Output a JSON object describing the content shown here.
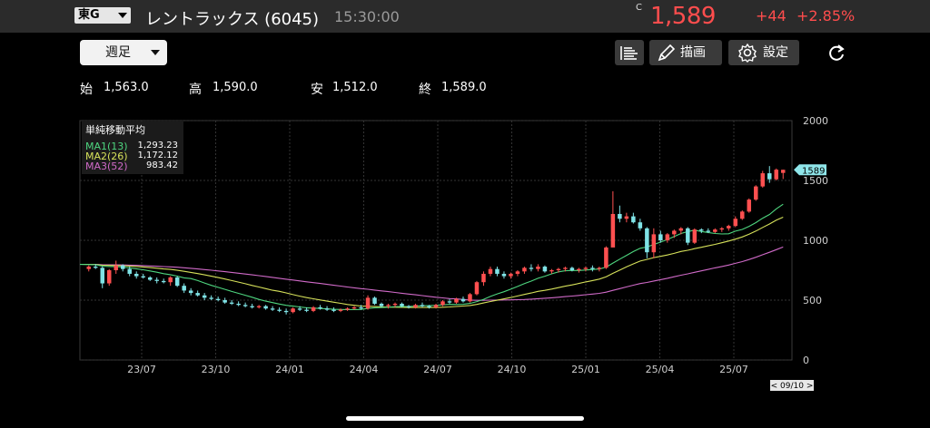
{
  "header": {
    "market": "東G",
    "name": "レントラックス (6045)",
    "time": "15:30:00",
    "close_flag": "C",
    "price": "1,589",
    "change": "+44",
    "change_pct": "+2.85%"
  },
  "toolbar": {
    "period": "週足",
    "draw_label": "描画",
    "settings_label": "設定",
    "list_icon": "list-icon",
    "draw_icon": "pencil-icon",
    "settings_icon": "gear-icon",
    "refresh_icon": "refresh-icon"
  },
  "ohlc": {
    "open_label": "始",
    "open": "1,563.0",
    "high_label": "高",
    "high": "1,590.0",
    "low_label": "安",
    "low": "1,512.0",
    "close_label": "終",
    "close": "1,589.0"
  },
  "colors": {
    "up": "#ff5050",
    "down": "#7fe3e6",
    "ma1": "#4ed67f",
    "ma2": "#d6e15a",
    "ma3": "#d06ac8"
  },
  "chart_data": {
    "type": "candlestick",
    "ma_title": "単純移動平均",
    "ma": [
      {
        "name": "MA1(13)",
        "value": "1,293.23"
      },
      {
        "name": "MA2(26)",
        "value": "1,172.12"
      },
      {
        "name": "MA3(52)",
        "value": "983.42"
      }
    ],
    "y_ticks": [
      "2000",
      "1500",
      "1000",
      "500",
      "0"
    ],
    "y_tick_values": [
      2000,
      1500,
      1000,
      500,
      0
    ],
    "ylim": [
      0,
      2000
    ],
    "x_ticks": [
      "23/07",
      "23/10",
      "24/01",
      "24/04",
      "24/07",
      "24/10",
      "25/01",
      "25/04",
      "25/07"
    ],
    "last_price_label": "1589",
    "last_price": 1589,
    "date_label": "< 09/10 >",
    "candles": [
      [
        760,
        790,
        740,
        780
      ],
      [
        780,
        800,
        760,
        770
      ],
      [
        770,
        780,
        600,
        640
      ],
      [
        640,
        760,
        620,
        750
      ],
      [
        750,
        830,
        720,
        790
      ],
      [
        790,
        800,
        740,
        760
      ],
      [
        760,
        780,
        700,
        720
      ],
      [
        720,
        740,
        680,
        700
      ],
      [
        700,
        720,
        680,
        690
      ],
      [
        690,
        700,
        660,
        670
      ],
      [
        670,
        690,
        640,
        660
      ],
      [
        660,
        680,
        640,
        650
      ],
      [
        650,
        700,
        620,
        690
      ],
      [
        690,
        700,
        610,
        620
      ],
      [
        620,
        640,
        560,
        580
      ],
      [
        580,
        600,
        540,
        560
      ],
      [
        560,
        580,
        530,
        540
      ],
      [
        540,
        560,
        500,
        520
      ],
      [
        520,
        540,
        500,
        510
      ],
      [
        510,
        530,
        490,
        500
      ],
      [
        500,
        520,
        470,
        480
      ],
      [
        480,
        500,
        460,
        470
      ],
      [
        470,
        490,
        450,
        460
      ],
      [
        460,
        480,
        440,
        450
      ],
      [
        450,
        470,
        430,
        440
      ],
      [
        440,
        460,
        430,
        450
      ],
      [
        450,
        460,
        420,
        430
      ],
      [
        430,
        450,
        410,
        420
      ],
      [
        420,
        440,
        400,
        410
      ],
      [
        410,
        430,
        380,
        400
      ],
      [
        400,
        440,
        390,
        430
      ],
      [
        430,
        450,
        410,
        420
      ],
      [
        420,
        440,
        400,
        410
      ],
      [
        410,
        450,
        400,
        440
      ],
      [
        440,
        460,
        420,
        430
      ],
      [
        430,
        450,
        410,
        420
      ],
      [
        420,
        440,
        400,
        410
      ],
      [
        410,
        430,
        400,
        420
      ],
      [
        420,
        440,
        410,
        430
      ],
      [
        430,
        450,
        420,
        440
      ],
      [
        440,
        460,
        420,
        430
      ],
      [
        430,
        540,
        420,
        520
      ],
      [
        520,
        530,
        460,
        470
      ],
      [
        470,
        480,
        440,
        450
      ],
      [
        450,
        470,
        430,
        460
      ],
      [
        460,
        480,
        440,
        470
      ],
      [
        470,
        480,
        440,
        450
      ],
      [
        450,
        460,
        430,
        440
      ],
      [
        440,
        470,
        430,
        460
      ],
      [
        460,
        480,
        440,
        450
      ],
      [
        450,
        460,
        430,
        440
      ],
      [
        440,
        470,
        430,
        460
      ],
      [
        460,
        500,
        450,
        490
      ],
      [
        490,
        510,
        470,
        480
      ],
      [
        480,
        520,
        470,
        510
      ],
      [
        510,
        530,
        480,
        490
      ],
      [
        490,
        560,
        480,
        550
      ],
      [
        550,
        660,
        540,
        650
      ],
      [
        650,
        740,
        620,
        720
      ],
      [
        720,
        780,
        700,
        760
      ],
      [
        760,
        780,
        700,
        720
      ],
      [
        720,
        740,
        680,
        700
      ],
      [
        700,
        730,
        680,
        720
      ],
      [
        720,
        750,
        700,
        740
      ],
      [
        740,
        780,
        720,
        770
      ],
      [
        770,
        800,
        740,
        760
      ],
      [
        760,
        800,
        740,
        780
      ],
      [
        780,
        790,
        730,
        740
      ],
      [
        740,
        760,
        720,
        750
      ],
      [
        750,
        770,
        730,
        760
      ],
      [
        760,
        780,
        740,
        770
      ],
      [
        770,
        780,
        740,
        750
      ],
      [
        750,
        770,
        730,
        760
      ],
      [
        760,
        780,
        740,
        770
      ],
      [
        770,
        790,
        740,
        760
      ],
      [
        760,
        780,
        740,
        770
      ],
      [
        770,
        950,
        760,
        940
      ],
      [
        940,
        1410,
        1100,
        1220
      ],
      [
        1220,
        1290,
        1150,
        1180
      ],
      [
        1180,
        1230,
        1150,
        1200
      ],
      [
        1200,
        1230,
        1140,
        1150
      ],
      [
        1150,
        1180,
        1080,
        1100
      ],
      [
        1100,
        1110,
        850,
        900
      ],
      [
        900,
        1100,
        850,
        1050
      ],
      [
        1050,
        1080,
        980,
        1000
      ],
      [
        1000,
        1060,
        980,
        1050
      ],
      [
        1050,
        1090,
        1020,
        1080
      ],
      [
        1080,
        1110,
        1050,
        1100
      ],
      [
        1100,
        1110,
        960,
        980
      ],
      [
        980,
        1100,
        970,
        1090
      ],
      [
        1090,
        1100,
        1060,
        1080
      ],
      [
        1080,
        1100,
        1060,
        1070
      ],
      [
        1070,
        1100,
        1060,
        1090
      ],
      [
        1090,
        1110,
        1070,
        1100
      ],
      [
        1100,
        1130,
        1080,
        1120
      ],
      [
        1120,
        1200,
        1110,
        1180
      ],
      [
        1180,
        1250,
        1170,
        1240
      ],
      [
        1240,
        1350,
        1230,
        1340
      ],
      [
        1340,
        1460,
        1330,
        1450
      ],
      [
        1450,
        1580,
        1440,
        1560
      ],
      [
        1560,
        1620,
        1480,
        1510
      ],
      [
        1510,
        1600,
        1500,
        1590
      ],
      [
        1563,
        1590,
        1512,
        1589
      ]
    ]
  }
}
